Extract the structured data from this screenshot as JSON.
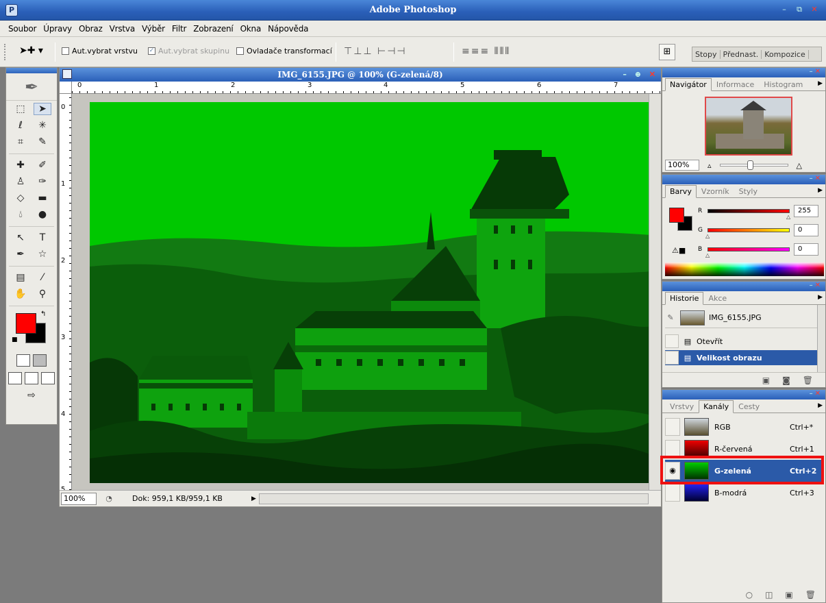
{
  "app": {
    "title": "Adobe Photoshop"
  },
  "menu": [
    "Soubor",
    "Úpravy",
    "Obraz",
    "Vrstva",
    "Výběr",
    "Filtr",
    "Zobrazení",
    "Okna",
    "Nápověda"
  ],
  "options": {
    "auto_select_layer": "Aut.vybrat vrstvu",
    "auto_select_group": "Aut.vybrat skupinu",
    "transform_controls": "Ovladače transformací",
    "panel_tabs": [
      "Stopy",
      "Přednast.",
      "Kompozice"
    ]
  },
  "document": {
    "title": "IMG_6155.JPG @ 100% (G-zelená/8)",
    "zoom": "100%",
    "doc_info": "Dok: 959,1 KB/959,1 KB",
    "ruler_h": [
      "0",
      "1",
      "2",
      "3",
      "4",
      "5",
      "6",
      "7"
    ],
    "ruler_v": [
      "0",
      "1",
      "2",
      "3",
      "4",
      "5"
    ]
  },
  "navigator": {
    "tabs": [
      "Navigátor",
      "Informace",
      "Histogram"
    ],
    "zoom": "100%"
  },
  "color": {
    "tabs": [
      "Barvy",
      "Vzorník",
      "Styly"
    ],
    "labels": {
      "r": "R",
      "g": "G",
      "b": "B"
    },
    "r": "255",
    "g": "0",
    "b": "0",
    "foreground": "#ff0000",
    "background": "#000000"
  },
  "history": {
    "tabs": [
      "Historie",
      "Akce"
    ],
    "snapshot": "IMG_6155.JPG",
    "items": [
      "Otevřít",
      "Velikost obrazu"
    ]
  },
  "channels": {
    "tabs": [
      "Vrstvy",
      "Kanály",
      "Cesty"
    ],
    "rows": [
      {
        "name": "RGB",
        "shortcut": "Ctrl+*"
      },
      {
        "name": "R-červená",
        "shortcut": "Ctrl+1"
      },
      {
        "name": "G-zelená",
        "shortcut": "Ctrl+2"
      },
      {
        "name": "B-modrá",
        "shortcut": "Ctrl+3"
      }
    ]
  },
  "colors": {
    "accent": "#2b5aa8",
    "highlight": "#ee1111",
    "image_channel": "#00c800"
  }
}
